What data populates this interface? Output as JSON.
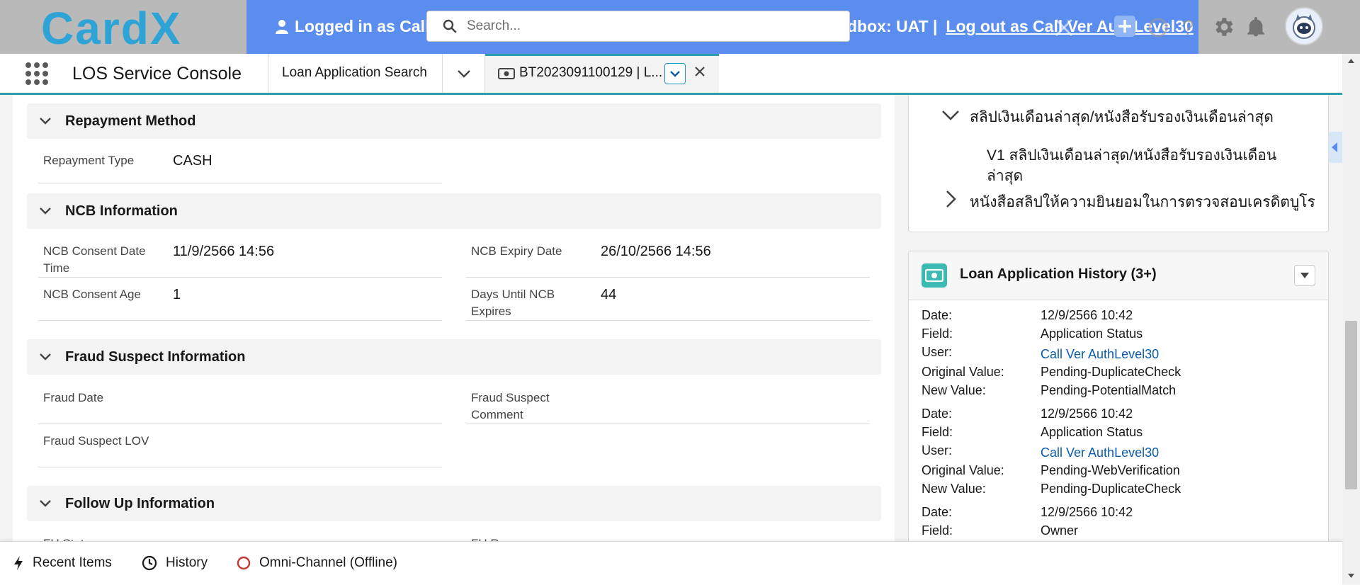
{
  "colors": {
    "brand_blue": "#5b8def",
    "teal_accent": "#2b9fb0",
    "link": "#0b5cab",
    "history_icon_bg": "#3bb9b3",
    "omni_status_red": "#c23934"
  },
  "header": {
    "logo_text": "CardX",
    "logged_in_text": "Logged in as Call",
    "sandbox_text": "dbox: UAT |",
    "logout_text": "Log out as Call Ver AuthLevel30",
    "search_placeholder": "Search...",
    "icons": [
      "user-icon",
      "search-icon",
      "add-icon",
      "help-icon",
      "setup-gear-icon",
      "notification-bell-icon",
      "avatar"
    ]
  },
  "nav": {
    "app_name": "LOS Service Console",
    "tabs": [
      {
        "label": "Loan Application Search"
      },
      {
        "label": "BT2023091100129 | L..."
      }
    ]
  },
  "main": {
    "sections": {
      "repayment": {
        "title": "Repayment Method",
        "fields": [
          {
            "label": "Repayment Type",
            "value": "CASH"
          }
        ]
      },
      "ncb": {
        "title": "NCB Information",
        "fields": [
          {
            "label": "NCB Consent Date Time",
            "value": "11/9/2566 14:56"
          },
          {
            "label": "NCB Expiry Date",
            "value": "26/10/2566 14:56"
          },
          {
            "label": "NCB Consent Age",
            "value": "1"
          },
          {
            "label": "Days Until NCB Expires",
            "value": "44"
          }
        ]
      },
      "fraud": {
        "title": "Fraud Suspect Information",
        "fields": [
          {
            "label": "Fraud Date",
            "value": ""
          },
          {
            "label": "Fraud Suspect Comment",
            "value": ""
          },
          {
            "label": "Fraud Suspect LOV",
            "value": ""
          }
        ]
      },
      "followup": {
        "title": "Follow Up Information",
        "fields": [
          {
            "label": "FU Status"
          },
          {
            "label": "FU R"
          }
        ]
      }
    }
  },
  "right": {
    "documents": {
      "folder_expanded": "สลิปเงินเดือนล่าสุด/หนังสือรับรองเงินเดือนล่าสุด",
      "doc_line1": "V1 สลิปเงินเดือนล่าสุด/หนังสือรับรองเงินเดือน",
      "doc_line2": "ล่าสุด",
      "folder_collapsed": "หนังสือสลิปให้ความยินยอมในการตรวจสอบเครดิตบูโร"
    },
    "history": {
      "title": "Loan Application History (3+)",
      "labels": {
        "date": "Date:",
        "field": "Field:",
        "user": "User:",
        "original": "Original Value:",
        "new": "New Value:"
      },
      "entries": [
        {
          "date": "12/9/2566 10:42",
          "field": "Application Status",
          "user": "Call Ver AuthLevel30",
          "original": "Pending-DuplicateCheck",
          "new": "Pending-PotentialMatch"
        },
        {
          "date": "12/9/2566 10:42",
          "field": "Application Status",
          "user": "Call Ver AuthLevel30",
          "original": "Pending-WebVerification",
          "new": "Pending-DuplicateCheck"
        },
        {
          "date": "12/9/2566 10:42",
          "field": "Owner"
        }
      ]
    }
  },
  "utility_bar": {
    "items": [
      {
        "label": "Recent Items",
        "icon": "lightning-icon"
      },
      {
        "label": "History",
        "icon": "clock-icon"
      },
      {
        "label": "Omni-Channel (Offline)",
        "icon": "presence-circle-icon"
      }
    ]
  }
}
